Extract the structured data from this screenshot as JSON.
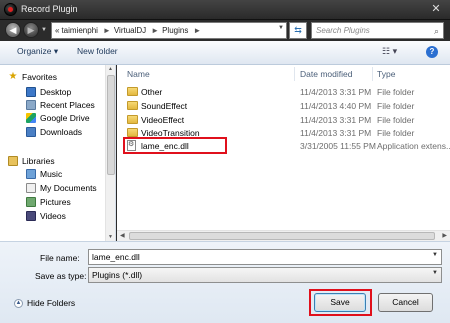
{
  "window": {
    "title": "Record Plugin"
  },
  "address": {
    "overflow": "«",
    "crumbs": [
      "taimienphi",
      "VirtualDJ",
      "Plugins"
    ],
    "separator": "►",
    "search_placeholder": "Search Plugins"
  },
  "toolbar": {
    "organize_label": "Organize ▾",
    "new_folder_label": "New folder"
  },
  "nav": {
    "favorites": "Favorites",
    "favorites_items": [
      "Desktop",
      "Recent Places",
      "Google Drive",
      "Downloads"
    ],
    "libraries": "Libraries",
    "libraries_items": [
      "Music",
      "My Documents",
      "Pictures",
      "Videos"
    ]
  },
  "files": {
    "headers": {
      "name": "Name",
      "date": "Date modified",
      "type": "Type"
    },
    "rows": [
      {
        "name": "Other",
        "date": "11/4/2013 3:31 PM",
        "type": "File folder",
        "icon": "folder-icon"
      },
      {
        "name": "SoundEffect",
        "date": "11/4/2013 4:40 PM",
        "type": "File folder",
        "icon": "folder-icon"
      },
      {
        "name": "VideoEffect",
        "date": "11/4/2013 3:31 PM",
        "type": "File folder",
        "icon": "folder-icon"
      },
      {
        "name": "VideoTransition",
        "date": "11/4/2013 3:31 PM",
        "type": "File folder",
        "icon": "folder-icon"
      },
      {
        "name": "lame_enc.dll",
        "date": "3/31/2005 11:55 PM",
        "type": "Application extens...",
        "icon": "dll-icon"
      }
    ]
  },
  "form": {
    "file_name_label": "File name:",
    "file_name_value": "lame_enc.dll",
    "save_as_type_label": "Save as type:",
    "save_as_type_value": "Plugins (*.dll)"
  },
  "buttons": {
    "hide_folders": "Hide Folders",
    "save": "Save",
    "cancel": "Cancel"
  },
  "colors": {
    "highlight": "#e0101c",
    "toolbar_text": "#1e395b",
    "header_text": "#4c607a"
  }
}
